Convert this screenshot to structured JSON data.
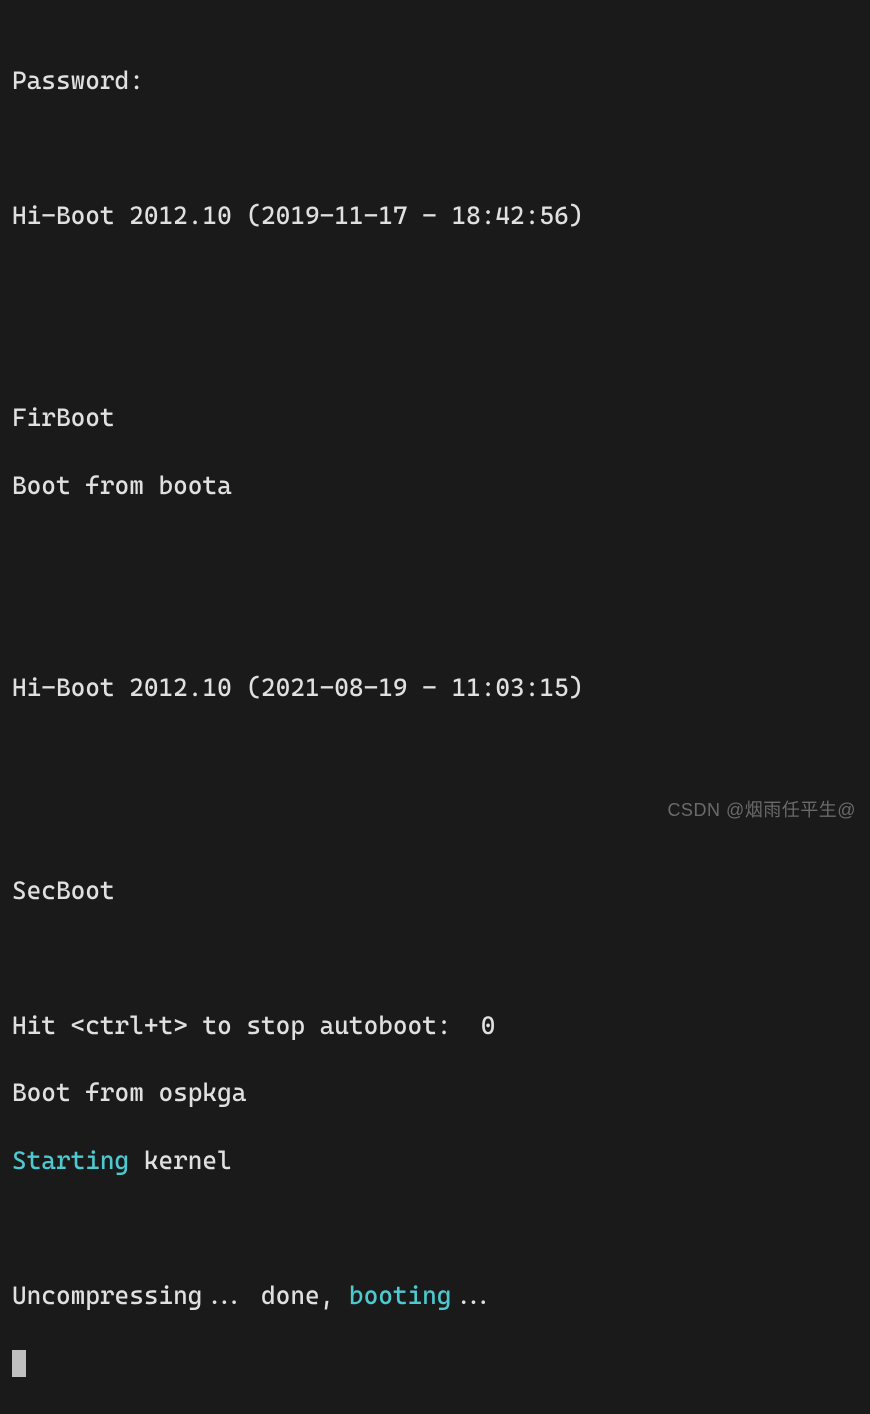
{
  "lines": {
    "l1": "Password:",
    "l2": "",
    "l3": "Hi-Boot 2012.10 (2019-11-17 - 18:42:56)",
    "l4": "",
    "l5": "",
    "l6": "FirBoot",
    "l7": "Boot from boota",
    "l8": "",
    "l9": "",
    "l10": "Hi-Boot 2012.10 (2021-08-19 - 11:03:15)",
    "l11": "",
    "l12": "",
    "l13": "SecBoot",
    "l14": "",
    "l15": "Hit <ctrl+t> to stop autoboot:  0",
    "l16": "Boot from ospkga",
    "l17a": "Starting",
    "l17b": " kernel",
    "l18": "",
    "l19a": "Uncompressing... done, ",
    "l19b": "booting",
    "l19c": "..."
  },
  "watermark": "CSDN @烟雨任平生@"
}
